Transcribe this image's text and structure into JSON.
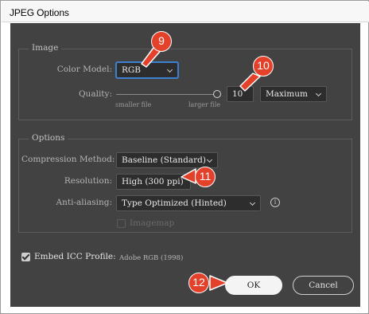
{
  "window": {
    "title": "JPEG Options"
  },
  "image_section": {
    "legend": "Image",
    "color_model_label": "Color Model:",
    "color_model_value": "RGB",
    "quality_label": "Quality:",
    "quality_min_label": "smaller file",
    "quality_max_label": "larger file",
    "quality_value": "10",
    "quality_preset": "Maximum"
  },
  "options_section": {
    "legend": "Options",
    "compression_label": "Compression Method:",
    "compression_value": "Baseline (Standard)",
    "resolution_label": "Resolution:",
    "resolution_value": "High (300 ppi)",
    "antialias_label": "Anti-aliasing:",
    "antialias_value": "Type Optimized (Hinted)",
    "imagemap_label": "Imagemap",
    "imagemap_checked": false
  },
  "embed_icc": {
    "label": "Embed ICC Profile:",
    "profile": "Adobe RGB (1998)",
    "checked": true
  },
  "buttons": {
    "ok": "OK",
    "cancel": "Cancel"
  },
  "callouts": [
    "9",
    "10",
    "11",
    "12"
  ],
  "colors": {
    "callout": "#e4412a",
    "dialog_bg": "#424242",
    "focus": "#3e7fd0"
  },
  "icons": {
    "info": "info-icon",
    "dropdown": "chevron-down-icon",
    "check": "checkmark-icon"
  }
}
